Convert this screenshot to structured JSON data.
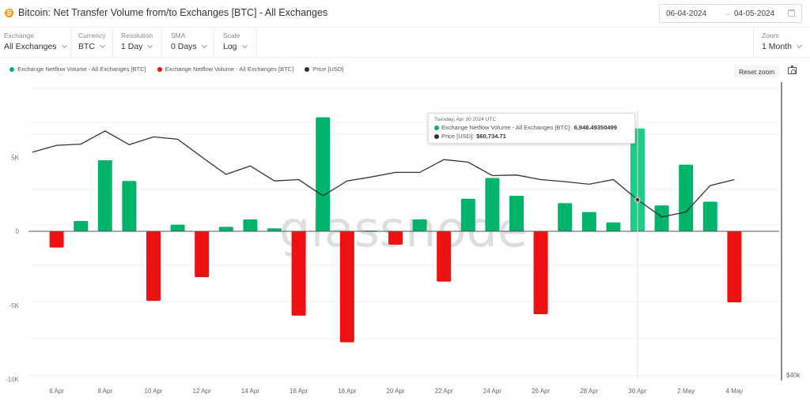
{
  "header": {
    "title": "Bitcoin: Net Transfer Volume from/to Exchanges [BTC] - All Exchanges",
    "icon": "bitcoin-icon",
    "date_from": "06-04-2024",
    "date_sep": "→",
    "date_to": "04-05-2024"
  },
  "controls": [
    {
      "label": "Exchange",
      "value": "All Exchanges"
    },
    {
      "label": "Currency",
      "value": "BTC"
    },
    {
      "label": "Resolution",
      "value": "1 Day"
    },
    {
      "label": "SMA",
      "value": "0 Days"
    },
    {
      "label": "Scale",
      "value": "Log"
    }
  ],
  "zoom_control": {
    "label": "Zoom",
    "value": "1 Month"
  },
  "toolbar": {
    "reset_zoom": "Reset zoom"
  },
  "legend": [
    {
      "label": "Exchange Netflow Volume - All Exchanges [BTC]",
      "color": "#00b36b"
    },
    {
      "label": "Exchange Netflow Volume - All Exchanges [BTC]",
      "color": "#ee1111"
    },
    {
      "label": "Price [USD]",
      "color": "#333333"
    }
  ],
  "tooltip": {
    "date": "Tuesday, Apr 30 2024 UTC",
    "series_label": "Exchange Netflow Volume - All Exchanges [BTC]: ",
    "series_value": "6,948.49350499",
    "price_label": "Price [USD]: ",
    "price_value": "$60,734.71"
  },
  "watermark": "glassnode",
  "colors": {
    "positive": "#00b36b",
    "positive_hover": "#1ecc86",
    "negative": "#ee1111",
    "price": "#333333"
  },
  "chart_data": {
    "type": "bar",
    "title": "Bitcoin: Net Transfer Volume from/to Exchanges [BTC] - All Exchanges",
    "xlabel": "",
    "ylabel": "",
    "x": [
      "5 Apr",
      "6 Apr",
      "7 Apr",
      "8 Apr",
      "9 Apr",
      "10 Apr",
      "11 Apr",
      "12 Apr",
      "13 Apr",
      "14 Apr",
      "15 Apr",
      "16 Apr",
      "17 Apr",
      "18 Apr",
      "19 Apr",
      "20 Apr",
      "21 Apr",
      "22 Apr",
      "23 Apr",
      "24 Apr",
      "25 Apr",
      "26 Apr",
      "27 Apr",
      "28 Apr",
      "29 Apr",
      "30 Apr",
      "1 May",
      "2 May",
      "3 May",
      "4 May"
    ],
    "x_ticks": [
      "6 Apr",
      "8 Apr",
      "10 Apr",
      "12 Apr",
      "14 Apr",
      "16 Apr",
      "18 Apr",
      "20 Apr",
      "22 Apr",
      "24 Apr",
      "26 Apr",
      "28 Apr",
      "30 Apr",
      "2 May",
      "4 May"
    ],
    "y_ticks": [
      "5K",
      "0",
      "-5K",
      "-10K"
    ],
    "y_tick_values": [
      5000,
      0,
      -5000,
      -10000
    ],
    "ylim": [
      -10000,
      10000
    ],
    "y2_ticks": [
      "$40k"
    ],
    "y2_scale": "log",
    "grid": true,
    "legend_position": "top-left",
    "series": [
      {
        "name": "Exchange Netflow Volume - All Exchanges [BTC]",
        "type": "bar",
        "values": [
          null,
          -1100,
          700,
          4800,
          3400,
          -4700,
          450,
          -3100,
          300,
          800,
          200,
          -5700,
          7700,
          -7500,
          50,
          -900,
          800,
          -3400,
          2200,
          3600,
          2400,
          -5600,
          1900,
          1300,
          600,
          6948.49,
          1750,
          4500,
          2000,
          -4800
        ]
      },
      {
        "name": "Price [USD]",
        "type": "line",
        "axis": "right",
        "values": [
          68000,
          69100,
          69300,
          71500,
          69200,
          70500,
          70100,
          67200,
          64500,
          65800,
          63500,
          63700,
          61300,
          63500,
          64100,
          64800,
          64800,
          66800,
          66400,
          64300,
          64400,
          63700,
          63400,
          63000,
          63700,
          60734.71,
          58300,
          59000,
          62800,
          63700
        ]
      }
    ],
    "highlight": {
      "x": "30 Apr",
      "netflow": 6948.49350499,
      "price": 60734.71
    }
  }
}
